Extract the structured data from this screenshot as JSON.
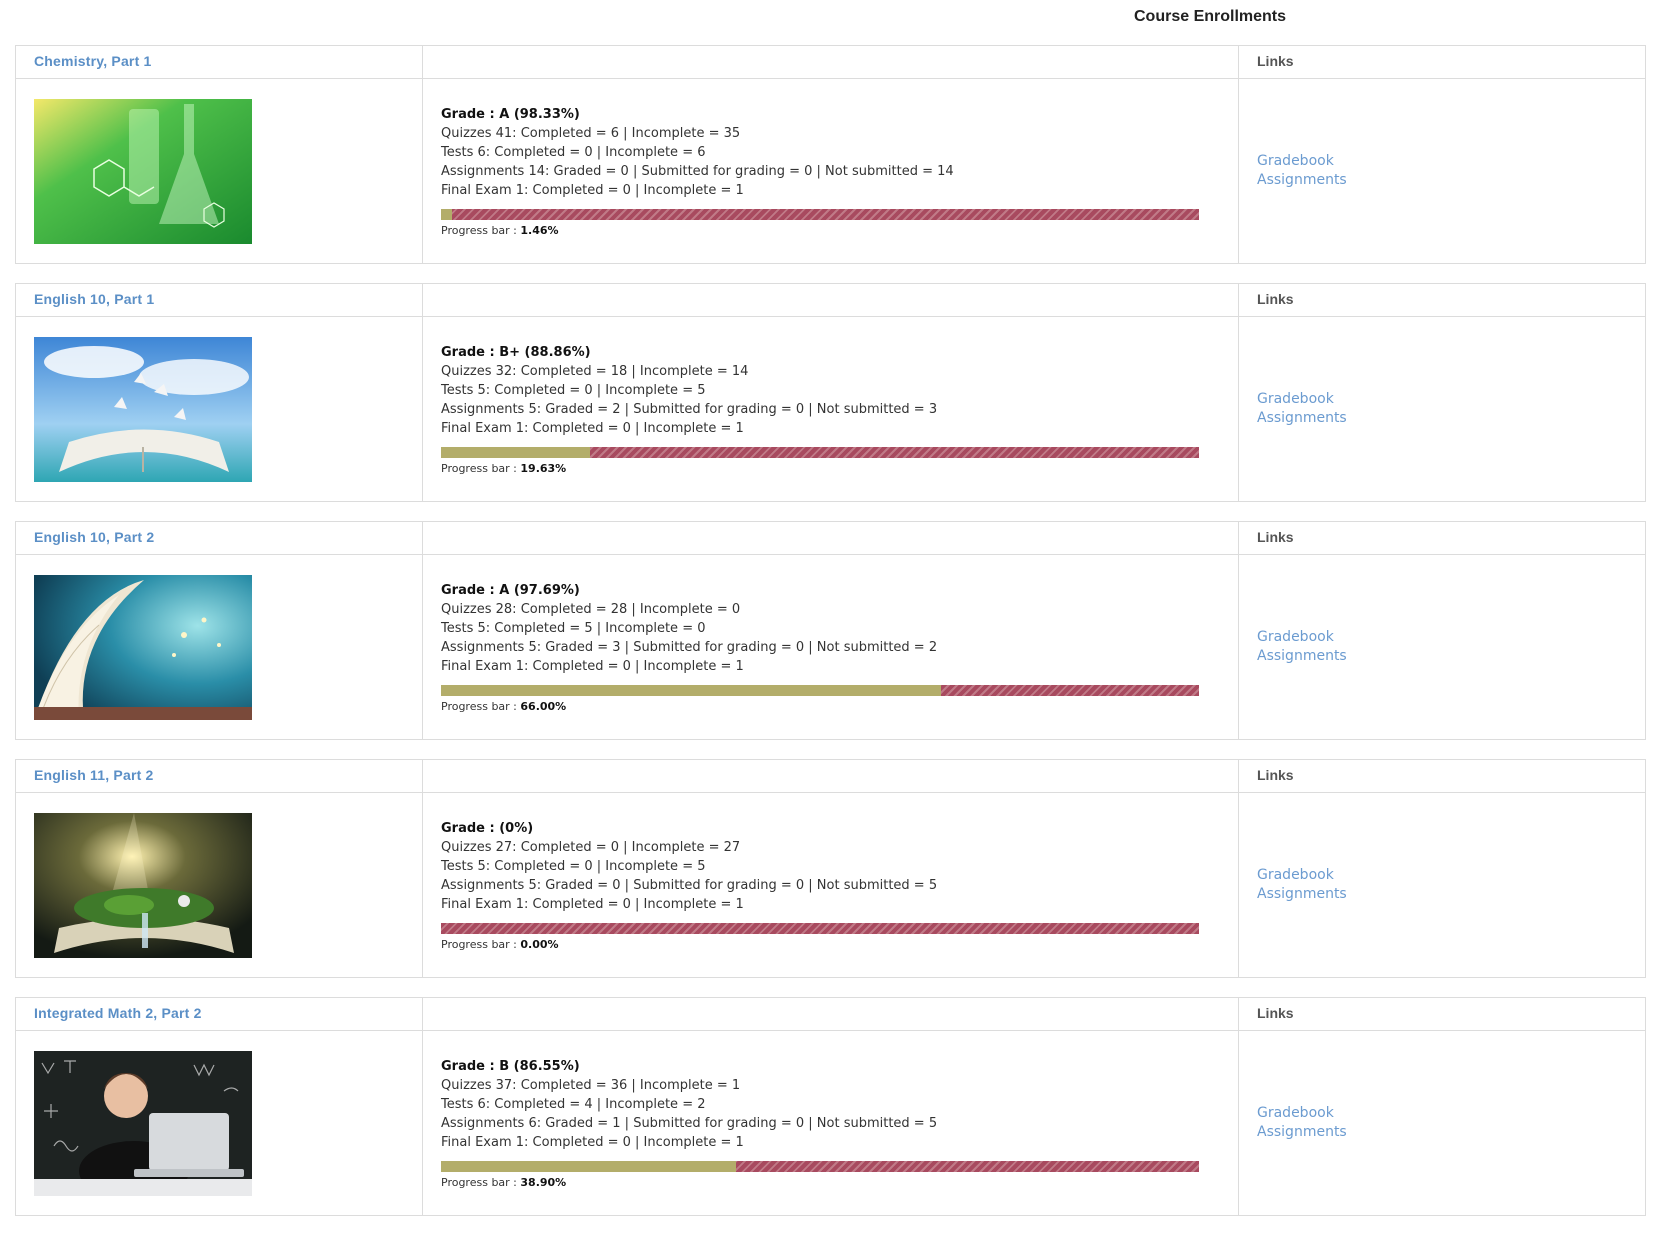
{
  "page": {
    "title": "Course Enrollments"
  },
  "labels": {
    "links_header": "Links",
    "progress_label": "Progress bar :"
  },
  "colors": {
    "link": "#5b8fc6",
    "progress_done": "#b3ad6a",
    "progress_remaining": "#a84a5f"
  },
  "courses": [
    {
      "name": "Chemistry, Part 1",
      "image_icon": "chemistry-glassware-image",
      "grade": "Grade : A (98.33%)",
      "quizzes": "Quizzes 41: Completed = 6 | Incomplete = 35",
      "tests": "Tests 6: Completed = 0 | Incomplete = 6",
      "assignments": "Assignments 14: Graded = 0 | Submitted for grading = 0 | Not submitted = 14",
      "final_exam": "Final Exam 1: Completed = 0 | Incomplete = 1",
      "progress": 1.46,
      "progress_text": "1.46%",
      "links": [
        "Gradebook",
        "Assignments"
      ]
    },
    {
      "name": "English 10, Part 1",
      "image_icon": "book-butterflies-sky-image",
      "grade": "Grade : B+ (88.86%)",
      "quizzes": "Quizzes 32: Completed = 18 | Incomplete = 14",
      "tests": "Tests 5: Completed = 0 | Incomplete = 5",
      "assignments": "Assignments 5: Graded = 2 | Submitted for grading = 0 | Not submitted = 3",
      "final_exam": "Final Exam 1: Completed = 0 | Incomplete = 1",
      "progress": 19.63,
      "progress_text": "19.63%",
      "links": [
        "Gradebook",
        "Assignments"
      ]
    },
    {
      "name": "English 10, Part 2",
      "image_icon": "open-book-pages-image",
      "grade": "Grade : A (97.69%)",
      "quizzes": "Quizzes 28: Completed = 28 | Incomplete = 0",
      "tests": "Tests 5: Completed = 5 | Incomplete = 0",
      "assignments": "Assignments 5: Graded = 3 | Submitted for grading = 0 | Not submitted = 2",
      "final_exam": "Final Exam 1: Completed = 0 | Incomplete = 1",
      "progress": 66.0,
      "progress_text": "66.00%",
      "links": [
        "Gradebook",
        "Assignments"
      ]
    },
    {
      "name": "English 11, Part 2",
      "image_icon": "fantasy-forest-book-image",
      "grade": "Grade : (0%)",
      "quizzes": "Quizzes 27: Completed = 0 | Incomplete = 27",
      "tests": "Tests 5: Completed = 0 | Incomplete = 5",
      "assignments": "Assignments 5: Graded = 0 | Submitted for grading = 0 | Not submitted = 5",
      "final_exam": "Final Exam 1: Completed = 0 | Incomplete = 1",
      "progress": 0.0,
      "progress_text": "0.00%",
      "links": [
        "Gradebook",
        "Assignments"
      ]
    },
    {
      "name": "Integrated Math 2, Part 2",
      "image_icon": "student-laptop-chalkboard-image",
      "grade": "Grade : B (86.55%)",
      "quizzes": "Quizzes 37: Completed = 36 | Incomplete = 1",
      "tests": "Tests 6: Completed = 4 | Incomplete = 2",
      "assignments": "Assignments 6: Graded = 1 | Submitted for grading = 0 | Not submitted = 5",
      "final_exam": "Final Exam 1: Completed = 0 | Incomplete = 1",
      "progress": 38.9,
      "progress_text": "38.90%",
      "links": [
        "Gradebook",
        "Assignments"
      ]
    }
  ]
}
